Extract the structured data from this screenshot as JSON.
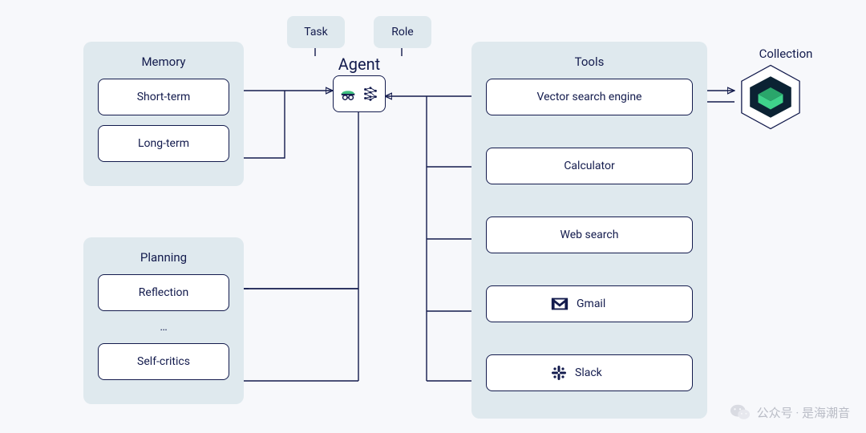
{
  "agent": {
    "label": "Agent"
  },
  "chips": {
    "task": "Task",
    "role": "Role"
  },
  "memory": {
    "title": "Memory",
    "items": [
      "Short-term",
      "Long-term"
    ]
  },
  "planning": {
    "title": "Planning",
    "items": [
      "Reflection",
      "Self-critics"
    ],
    "ellipsis": "…"
  },
  "tools": {
    "title": "Tools",
    "items": [
      {
        "label": "Vector search engine",
        "icon": "none"
      },
      {
        "label": "Calculator",
        "icon": "none"
      },
      {
        "label": "Web search",
        "icon": "none"
      },
      {
        "label": "Gmail",
        "icon": "gmail"
      },
      {
        "label": "Slack",
        "icon": "slack"
      }
    ]
  },
  "collection": {
    "title": "Collection"
  },
  "watermark": {
    "text": "公众号 · 是海潮音"
  },
  "colors": {
    "panel": "#dfe9ee",
    "border": "#131b4d",
    "bg": "#f7f8fb",
    "accent_green": "#3fbf7f",
    "weaviate_dark": "#0b2233",
    "weaviate_green": "#3fd28b"
  }
}
